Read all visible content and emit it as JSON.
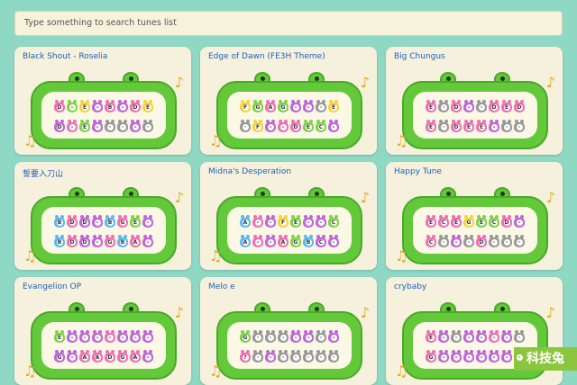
{
  "search": {
    "placeholder": "Type something to search tunes list"
  },
  "cards": [
    {
      "title": "Black Shout - Roselia",
      "row1": [
        [
          "D",
          "#f06fb4"
        ],
        [
          "–",
          "#7fd24a"
        ],
        [
          "E",
          "#f7d23c"
        ],
        [
          "–",
          "#c066d8"
        ],
        [
          "B",
          "#f06fb4"
        ],
        [
          "–",
          "#c066d8"
        ],
        [
          "D",
          "#f06fb4"
        ],
        [
          "E",
          "#f7d23c"
        ]
      ],
      "row2": [
        [
          "D",
          "#c066d8"
        ],
        [
          "–",
          "#f06fb4"
        ],
        [
          "E",
          "#7fd24a"
        ],
        [
          "–",
          "#c066d8"
        ],
        [
          "·",
          "#999999"
        ],
        [
          "·",
          "#999999"
        ],
        [
          "–",
          "#c066d8"
        ],
        [
          "·",
          "#999999"
        ]
      ]
    },
    {
      "title": "Edge of Dawn (FE3H Theme)",
      "row1": [
        [
          "F",
          "#f7d23c"
        ],
        [
          "G",
          "#7fd24a"
        ],
        [
          "A",
          "#f06fb4"
        ],
        [
          "G",
          "#7fd24a"
        ],
        [
          "–",
          "#c066d8"
        ],
        [
          "–",
          "#c066d8"
        ],
        [
          "·",
          "#999999"
        ],
        [
          "E",
          "#f7d23c"
        ]
      ],
      "row2": [
        [
          "·",
          "#999999"
        ],
        [
          "F",
          "#f7d23c"
        ],
        [
          "–",
          "#c066d8"
        ],
        [
          "–",
          "#f06fb4"
        ],
        [
          "D",
          "#f06fb4"
        ],
        [
          "E",
          "#7fd24a"
        ],
        [
          "C",
          "#7fd24a"
        ],
        [
          "–",
          "#c066d8"
        ]
      ]
    },
    {
      "title": "Big Chungus",
      "row1": [
        [
          "E",
          "#f06fb4"
        ],
        [
          "·",
          "#999999"
        ],
        [
          "D",
          "#f06fb4"
        ],
        [
          "–",
          "#c066d8"
        ],
        [
          "·",
          "#999999"
        ],
        [
          "D",
          "#f06fb4"
        ],
        [
          "E",
          "#f06fb4"
        ],
        [
          "D",
          "#f06fb4"
        ]
      ],
      "row2": [
        [
          "E",
          "#f06fb4"
        ],
        [
          "·",
          "#999999"
        ],
        [
          "D",
          "#f06fb4"
        ],
        [
          "E",
          "#f06fb4"
        ],
        [
          "E",
          "#f06fb4"
        ],
        [
          "–",
          "#c066d8"
        ],
        [
          "·",
          "#999999"
        ],
        [
          "·",
          "#999999"
        ]
      ]
    },
    {
      "title": "誓要入刀山",
      "row1": [
        [
          "B",
          "#5db8f0"
        ],
        [
          "D",
          "#f06fb4"
        ],
        [
          "D",
          "#c066d8"
        ],
        [
          "–",
          "#c066d8"
        ],
        [
          "B",
          "#5db8f0"
        ],
        [
          "G",
          "#f06fb4"
        ],
        [
          "E",
          "#7fd24a"
        ],
        [
          "–",
          "#c066d8"
        ]
      ],
      "row2": [
        [
          "B",
          "#5db8f0"
        ],
        [
          "D",
          "#f06fb4"
        ],
        [
          "D",
          "#c066d8"
        ],
        [
          "–",
          "#c066d8"
        ],
        [
          "G",
          "#f06fb4"
        ],
        [
          "B",
          "#5db8f0"
        ],
        [
          "A",
          "#f06fb4"
        ],
        [
          "–",
          "#c066d8"
        ]
      ]
    },
    {
      "title": "Midna's Desperation",
      "row1": [
        [
          "A",
          "#5db8f0"
        ],
        [
          "–",
          "#f06fb4"
        ],
        [
          "–",
          "#c066d8"
        ],
        [
          "F",
          "#f7d23c"
        ],
        [
          "E",
          "#7fd24a"
        ],
        [
          "–",
          "#c066d8"
        ],
        [
          "–",
          "#c066d8"
        ],
        [
          "C",
          "#7fd24a"
        ]
      ],
      "row2": [
        [
          "A",
          "#5db8f0"
        ],
        [
          "–",
          "#f06fb4"
        ],
        [
          "–",
          "#c066d8"
        ],
        [
          "A",
          "#f06fb4"
        ],
        [
          "G",
          "#7fd24a"
        ],
        [
          "B",
          "#5db8f0"
        ],
        [
          "C",
          "#c066d8"
        ],
        [
          "–",
          "#c066d8"
        ]
      ]
    },
    {
      "title": "Happy Tune",
      "row1": [
        [
          "E",
          "#f06fb4"
        ],
        [
          "C",
          "#f06fb4"
        ],
        [
          "E",
          "#f06fb4"
        ],
        [
          "G",
          "#f7d23c"
        ],
        [
          "E",
          "#7fd24a"
        ],
        [
          "C",
          "#7fd24a"
        ],
        [
          "D",
          "#f06fb4"
        ],
        [
          "–",
          "#c066d8"
        ]
      ],
      "row2": [
        [
          "C",
          "#f06fb4"
        ],
        [
          "·",
          "#999999"
        ],
        [
          "–",
          "#c066d8"
        ],
        [
          "·",
          "#999999"
        ],
        [
          "D",
          "#f06fb4"
        ],
        [
          "·",
          "#999999"
        ],
        [
          "·",
          "#999999"
        ],
        [
          "·",
          "#999999"
        ]
      ]
    },
    {
      "title": "Evangelion OP",
      "row1": [
        [
          "E",
          "#7fd24a"
        ],
        [
          "–",
          "#c066d8"
        ],
        [
          "–",
          "#c066d8"
        ],
        [
          "–",
          "#c066d8"
        ],
        [
          "–",
          "#f06fb4"
        ],
        [
          "–",
          "#c066d8"
        ],
        [
          "–",
          "#c066d8"
        ],
        [
          "–",
          "#c066d8"
        ]
      ],
      "row2": [
        [
          "G",
          "#c066d8"
        ],
        [
          "–",
          "#c066d8"
        ],
        [
          "A",
          "#f06fb4"
        ],
        [
          "A",
          "#f06fb4"
        ],
        [
          "D",
          "#f06fb4"
        ],
        [
          "G",
          "#f06fb4"
        ],
        [
          "A",
          "#f06fb4"
        ],
        [
          "–",
          "#c066d8"
        ]
      ]
    },
    {
      "title": "Melo e",
      "row1": [
        [
          "G",
          "#7fd24a"
        ],
        [
          "·",
          "#999999"
        ],
        [
          "·",
          "#999999"
        ],
        [
          "·",
          "#999999"
        ],
        [
          "–",
          "#c066d8"
        ],
        [
          "–",
          "#c066d8"
        ],
        [
          "·",
          "#999999"
        ],
        [
          "–",
          "#c066d8"
        ]
      ],
      "row2": [
        [
          "?",
          "#f06fb4"
        ],
        [
          "·",
          "#999999"
        ],
        [
          "–",
          "#c066d8"
        ],
        [
          "·",
          "#999999"
        ],
        [
          "·",
          "#999999"
        ],
        [
          "·",
          "#999999"
        ],
        [
          "·",
          "#999999"
        ],
        [
          "·",
          "#999999"
        ]
      ]
    },
    {
      "title": "crybaby",
      "row1": [
        [
          "E",
          "#f06fb4"
        ],
        [
          "–",
          "#c066d8"
        ],
        [
          "·",
          "#999999"
        ],
        [
          "–",
          "#c066d8"
        ],
        [
          "–",
          "#c066d8"
        ],
        [
          "–",
          "#f06fb4"
        ],
        [
          "–",
          "#c066d8"
        ],
        [
          "·",
          "#999999"
        ]
      ],
      "row2": [
        [
          "G",
          "#f06fb4"
        ],
        [
          "–",
          "#c066d8"
        ],
        [
          "–",
          "#c066d8"
        ],
        [
          "–",
          "#c066d8"
        ],
        [
          "–",
          "#c066d8"
        ],
        [
          "–",
          "#c066d8"
        ],
        [
          "–",
          "#c066d8"
        ],
        [
          "·",
          "#999999"
        ]
      ]
    }
  ],
  "watermark": "科技兔"
}
